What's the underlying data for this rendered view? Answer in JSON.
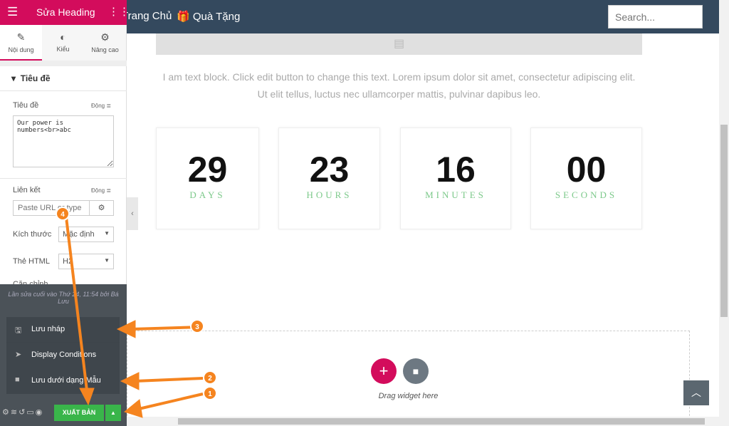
{
  "editor": {
    "title": "Sửa Heading",
    "tabs": [
      {
        "label": "Nội dung",
        "icon": "pencil-icon"
      },
      {
        "label": "Kiểu",
        "icon": "contrast-icon"
      },
      {
        "label": "Nâng cao",
        "icon": "gear-icon"
      }
    ],
    "section_title": "Tiêu đề",
    "title_label": "Tiêu đề",
    "dynamic_label": "Động",
    "title_value": "Our power is\nnumbers<br>abc",
    "link_label": "Liên kết",
    "link_placeholder": "Paste URL or type",
    "size_label": "Kích thước",
    "size_value": "Mặc định",
    "html_label": "Thẻ HTML",
    "html_value": "H2",
    "align_label": "Căn chỉnh",
    "last_edit": "Lần sửa cuối vào Thứ 24, 11:54 bởi Bá Lưu",
    "menu": [
      {
        "label": "Lưu nháp",
        "icon": "save-icon"
      },
      {
        "label": "Display Conditions",
        "icon": "paper-plane-icon"
      },
      {
        "label": "Lưu dưới dạng Mẫu",
        "icon": "folder-icon"
      }
    ],
    "publish_label": "XUẤT BẢN"
  },
  "nav": {
    "home": "Trang Chủ",
    "gifts": "Quà Tặng",
    "search_placeholder": "Search..."
  },
  "page": {
    "text_line1": "I am text block. Click edit button to change this text. Lorem ipsum dolor sit amet, consectetur adipiscing elit.",
    "text_line2": "Ut elit tellus, luctus nec ullamcorper mattis, pulvinar dapibus leo.",
    "countdown": [
      {
        "value": "29",
        "unit": "DAYS"
      },
      {
        "value": "23",
        "unit": "HOURS"
      },
      {
        "value": "16",
        "unit": "MINUTES"
      },
      {
        "value": "00",
        "unit": "SECONDS"
      }
    ],
    "drag_hint": "Drag widget here"
  },
  "annotations": [
    "1",
    "2",
    "3",
    "4"
  ],
  "colors": {
    "brand": "#d30c5c",
    "publish": "#39b54a",
    "arrow": "#f5841f",
    "nav": "#34495e"
  }
}
